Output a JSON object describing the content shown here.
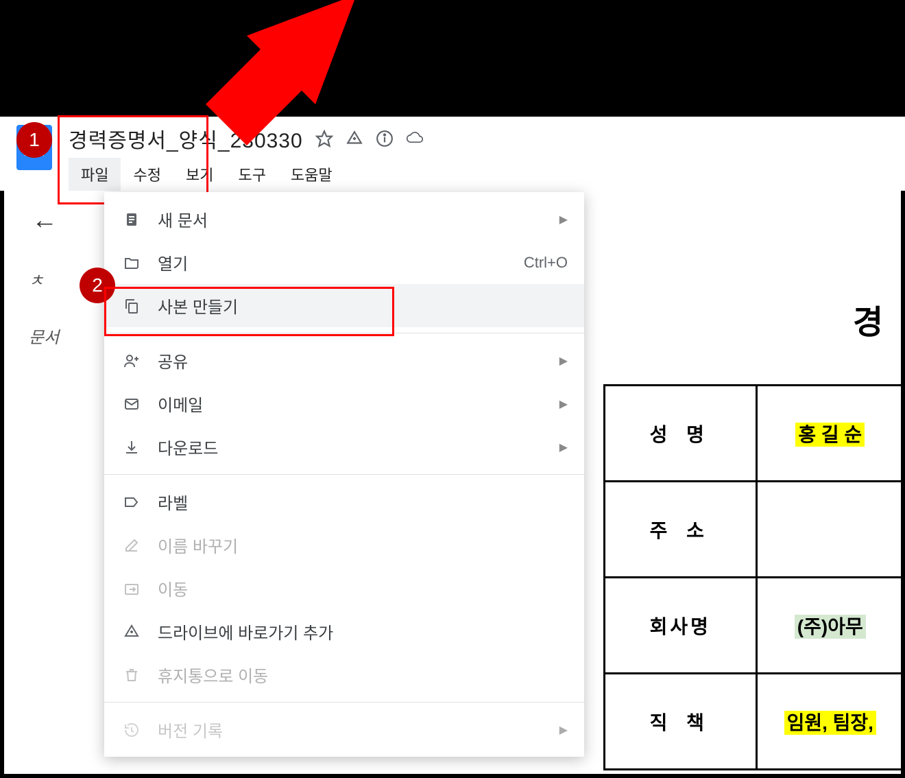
{
  "annotations": {
    "step1": "1",
    "step2": "2"
  },
  "header": {
    "title": "경력증명서_양식_230330"
  },
  "menubar": {
    "items": [
      {
        "label": "파일"
      },
      {
        "label": "수정"
      },
      {
        "label": "보기"
      },
      {
        "label": "도구"
      },
      {
        "label": "도움말"
      }
    ]
  },
  "sidebar": {
    "hint_char": "ㅊ",
    "doc_label": "문서"
  },
  "file_menu": {
    "items": [
      {
        "label": "새 문서",
        "shortcut": "",
        "has_sub": true,
        "disabled": false
      },
      {
        "label": "열기",
        "shortcut": "Ctrl+O",
        "has_sub": false,
        "disabled": false
      },
      {
        "label": "사본 만들기",
        "shortcut": "",
        "has_sub": false,
        "disabled": false
      },
      {
        "label": "공유",
        "shortcut": "",
        "has_sub": true,
        "disabled": false
      },
      {
        "label": "이메일",
        "shortcut": "",
        "has_sub": true,
        "disabled": false
      },
      {
        "label": "다운로드",
        "shortcut": "",
        "has_sub": true,
        "disabled": false
      },
      {
        "label": "라벨",
        "shortcut": "",
        "has_sub": false,
        "disabled": false
      },
      {
        "label": "이름 바꾸기",
        "shortcut": "",
        "has_sub": false,
        "disabled": true
      },
      {
        "label": "이동",
        "shortcut": "",
        "has_sub": false,
        "disabled": true
      },
      {
        "label": "드라이브에 바로가기 추가",
        "shortcut": "",
        "has_sub": false,
        "disabled": false
      },
      {
        "label": "휴지통으로 이동",
        "shortcut": "",
        "has_sub": false,
        "disabled": true
      },
      {
        "label": "버전 기록",
        "shortcut": "",
        "has_sub": true,
        "disabled": false
      }
    ]
  },
  "document": {
    "heading": "경",
    "rows": [
      {
        "label": "성 명",
        "value": "홍 길 순",
        "highlight": "yellow"
      },
      {
        "label": "주 소",
        "value": "",
        "highlight": ""
      },
      {
        "label": "회사명",
        "value": "(주)아무",
        "highlight": "green"
      },
      {
        "label": "직 책",
        "value": "임원, 팀장,",
        "highlight": "yellow"
      }
    ]
  }
}
